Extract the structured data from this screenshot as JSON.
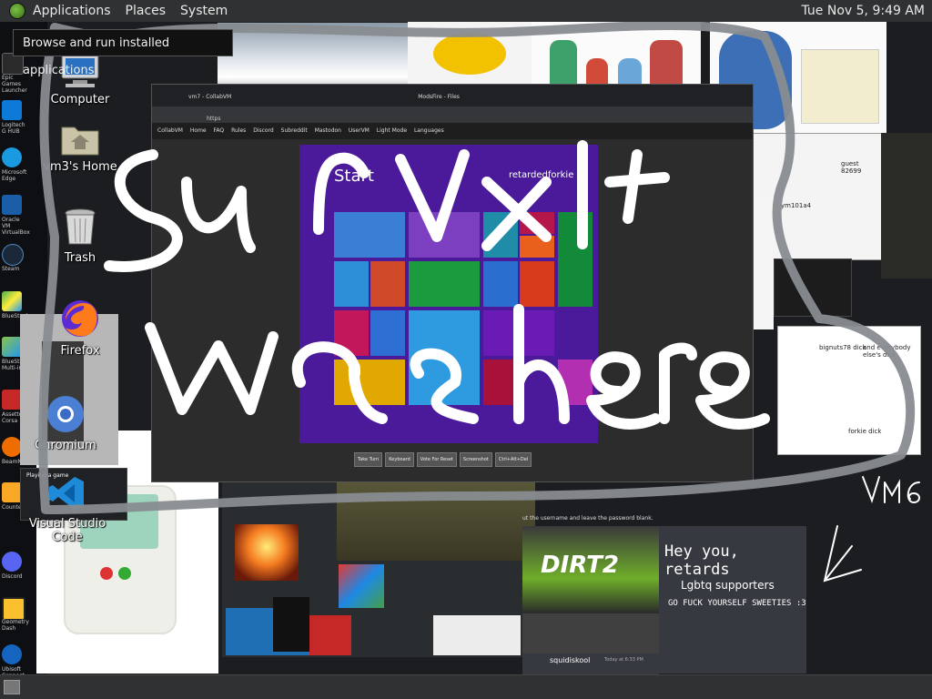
{
  "top_panel": {
    "applications": "Applications",
    "places": "Places",
    "system": "System",
    "clock": "Tue Nov 5,  9:49 AM"
  },
  "tooltip": "Browse and run installed applications",
  "desktop_icons": {
    "computer": "Computer",
    "home": "vm3's Home",
    "trash": "Trash",
    "firefox": "Firefox",
    "chromium": "Chromium",
    "vscode": "Visual Studio Code"
  },
  "left_strip": [
    {
      "label": "Epic Games Launcher",
      "color": "#2a2a2a"
    },
    {
      "label": "Logitech G HUB",
      "color": "#0c7ad6"
    },
    {
      "label": "Microsoft Edge",
      "color": "#1a9ae0"
    },
    {
      "label": "Oracle VM VirtualBox",
      "color": "#1b5ea8"
    },
    {
      "label": "Steam",
      "color": "#1b2838"
    },
    {
      "label": "BlueStacks",
      "color": "#4caf50"
    },
    {
      "label": "BlueStacks Multi-ins",
      "color": "#8bc34a"
    },
    {
      "label": "Assetto Corsa",
      "color": "#c62828"
    },
    {
      "label": "BeamNG",
      "color": "#ef6c00"
    },
    {
      "label": "Counter",
      "color": "#f9a825"
    },
    {
      "label": "Discord",
      "color": "#5865f2"
    },
    {
      "label": "Geometry Dash",
      "color": "#fbc02d"
    },
    {
      "label": "Ubisoft Connect",
      "color": "#1565c0"
    }
  ],
  "vm_window": {
    "tab_title": "vm7 - CollabVM",
    "tab2_title": "ModsFire - Files",
    "url": "https",
    "nav": [
      "CollabVM",
      "Home",
      "FAQ",
      "Rules",
      "Discord",
      "Subreddit",
      "Mastodon",
      "UserVM",
      "Light Mode",
      "Languages"
    ],
    "start": "Start",
    "user": "retardedforkie",
    "buttons": [
      "Take Turn",
      "Keyboard",
      "Vote For Reset",
      "Screenshot",
      "Ctrl+Alt+Del"
    ]
  },
  "graffiti": {
    "line1": "Sunvxlt",
    "line2": "was here",
    "tag": "VM6"
  },
  "notes": {
    "bignuts": "bignuts78 dick",
    "everybody": "and everybody else's dick",
    "forkie": "forkie dick",
    "guest": "guest 82699",
    "ym": "ym101a4"
  },
  "chat": {
    "header": "Hey you, retards",
    "sub": "Lgbtq supporters",
    "tagline": "GO FUCK YOURSELF SWEETIES :3",
    "message": "ut the username and leave the password blank."
  },
  "bottom_chat": {
    "user": "squidiskool",
    "time": "Today at 6:33 PM"
  },
  "car_banner": "DIRT2",
  "colors": {
    "panel": "#2f3133",
    "win8_bg": "#4a1a9a",
    "graffiti": "#ffffff"
  }
}
